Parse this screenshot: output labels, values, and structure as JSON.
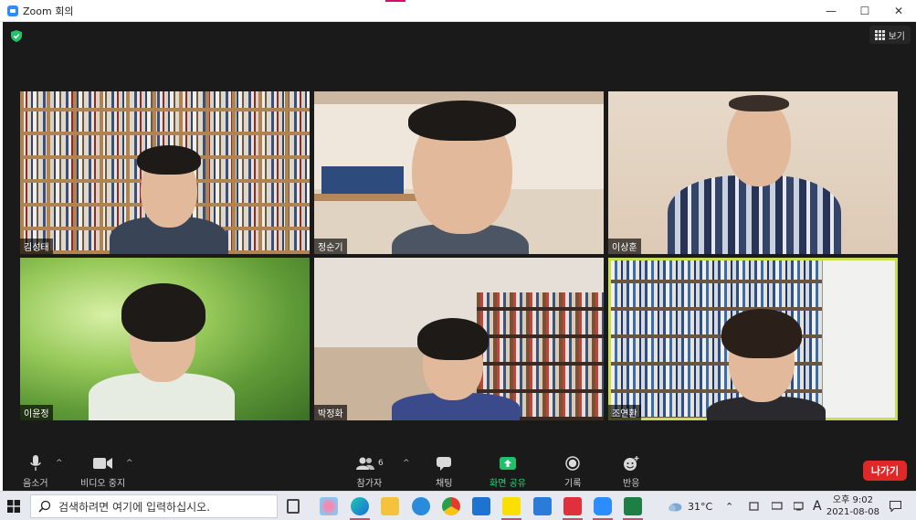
{
  "window": {
    "title": "Zoom 회의",
    "min_icon": "—",
    "max_icon": "☐",
    "close_icon": "✕"
  },
  "meeting": {
    "view_label": "보기",
    "participants": [
      {
        "name": "김성태"
      },
      {
        "name": "정순기"
      },
      {
        "name": "이상훈"
      },
      {
        "name": "이윤정"
      },
      {
        "name": "박정화"
      },
      {
        "name": "조연환"
      }
    ],
    "active_speaker_color": "#c8dd54"
  },
  "toolbar": {
    "mute_label": "음소거",
    "video_label": "비디오 중지",
    "participants_label": "참가자",
    "participants_count": "6",
    "chat_label": "채팅",
    "share_label": "화면 공유",
    "record_label": "기록",
    "reactions_label": "반응",
    "leave_label": "나가기",
    "caret": "^",
    "share_color": "#1fc26b",
    "leave_color": "#e02828"
  },
  "taskbar": {
    "search_placeholder": "검색하려면 여기에 입력하십시오.",
    "weather": "31°C",
    "ime": "A",
    "time": "오후 9:02",
    "date": "2021-08-08"
  }
}
